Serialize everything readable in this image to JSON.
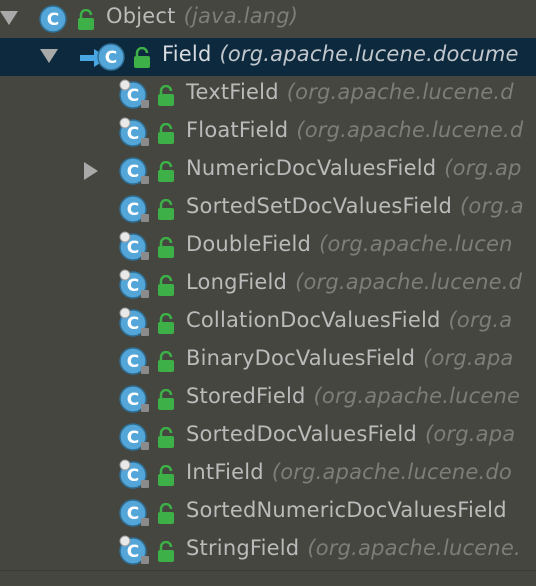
{
  "colors": {
    "background": "#45463f",
    "selection": "#0d293e",
    "text": "#bbbbbb",
    "package_text": "#7d7e76",
    "class_icon": "#55a6d8",
    "lock_icon": "#3db047",
    "impl_arrow": "#48a7e2"
  },
  "tree": {
    "items": [
      {
        "name": "Object",
        "package": "(java.lang)",
        "expanded": true,
        "selected": false,
        "icon": "class-icon",
        "access_icon": "unlock-icon"
      },
      {
        "name": "Field",
        "package": "(org.apache.lucene.docume",
        "expanded": true,
        "selected": true,
        "icon": "class-icon",
        "access_icon": "unlock-icon",
        "marker_icon": "implementation-arrow-icon"
      },
      {
        "name": "TextField",
        "package": "(org.apache.lucene.d",
        "final": true,
        "icon": "class-icon",
        "access_icon": "unlock-icon"
      },
      {
        "name": "FloatField",
        "package": "(org.apache.lucene.d",
        "final": true,
        "icon": "class-icon",
        "access_icon": "unlock-icon"
      },
      {
        "name": "NumericDocValuesField",
        "package": "(org.ap",
        "collapsed": true,
        "icon": "class-icon",
        "access_icon": "unlock-icon"
      },
      {
        "name": "SortedSetDocValuesField",
        "package": "(org.a",
        "icon": "class-icon",
        "access_icon": "unlock-icon"
      },
      {
        "name": "DoubleField",
        "package": "(org.apache.lucen",
        "final": true,
        "icon": "class-icon",
        "access_icon": "unlock-icon"
      },
      {
        "name": "LongField",
        "package": "(org.apache.lucene.d",
        "final": true,
        "icon": "class-icon",
        "access_icon": "unlock-icon"
      },
      {
        "name": "CollationDocValuesField",
        "package": "(org.a",
        "final": true,
        "icon": "class-icon",
        "access_icon": "unlock-icon"
      },
      {
        "name": "BinaryDocValuesField",
        "package": "(org.apa",
        "icon": "class-icon",
        "access_icon": "unlock-icon"
      },
      {
        "name": "StoredField",
        "package": "(org.apache.lucene",
        "icon": "class-icon",
        "access_icon": "unlock-icon"
      },
      {
        "name": "SortedDocValuesField",
        "package": "(org.apa",
        "icon": "class-icon",
        "access_icon": "unlock-icon"
      },
      {
        "name": "IntField",
        "package": "(org.apache.lucene.do",
        "final": true,
        "icon": "class-icon",
        "access_icon": "unlock-icon"
      },
      {
        "name": "SortedNumericDocValuesField",
        "package": "",
        "icon": "class-icon",
        "access_icon": "unlock-icon"
      },
      {
        "name": "StringField",
        "package": "(org.apache.lucene.",
        "final": true,
        "icon": "class-icon",
        "access_icon": "unlock-icon"
      }
    ]
  }
}
